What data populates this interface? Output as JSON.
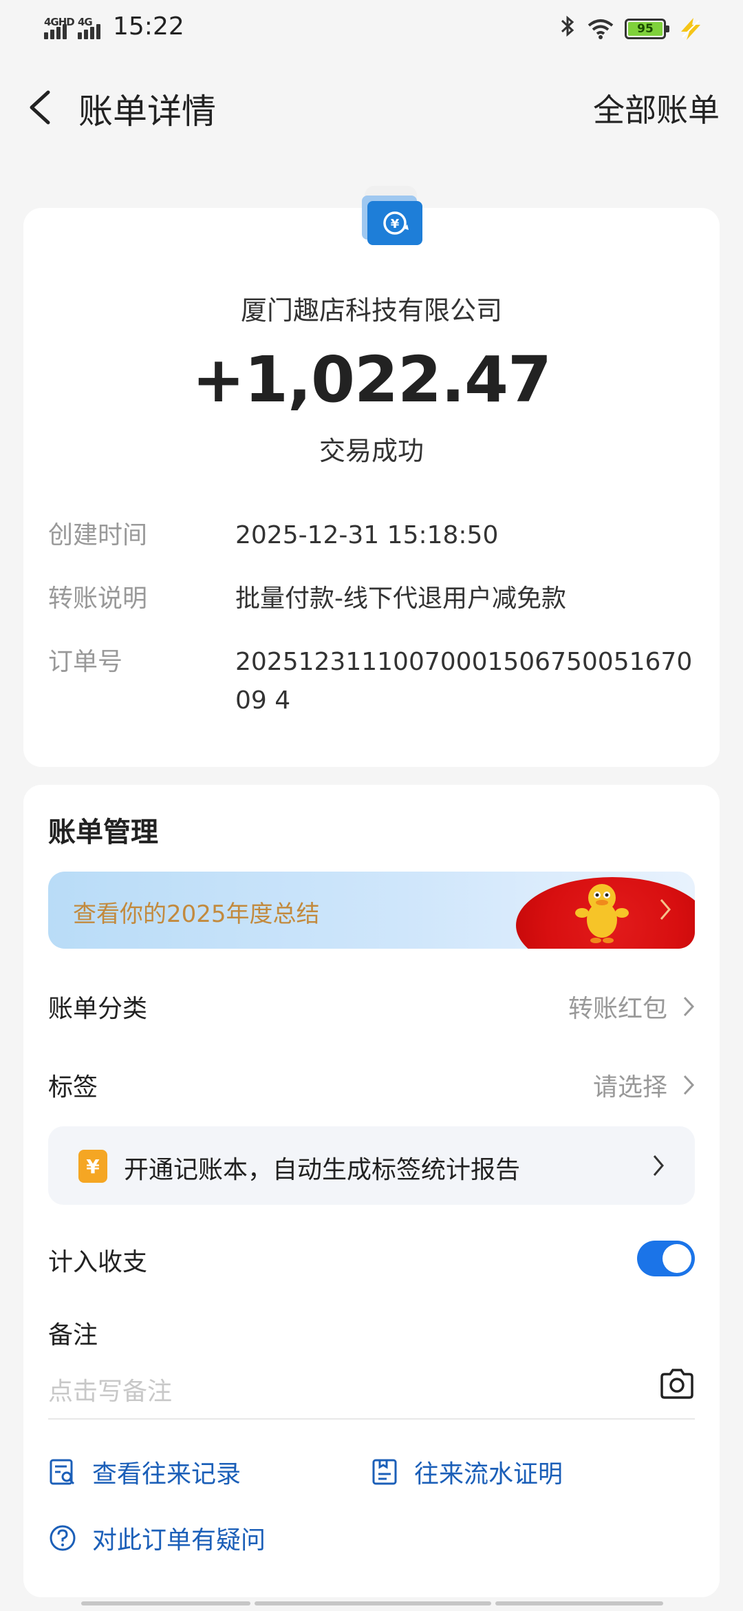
{
  "status_bar": {
    "signal1_label": "4GHD",
    "signal2_label": "4G",
    "time": "15:22",
    "battery": "95"
  },
  "header": {
    "title": "账单详情",
    "all_bills": "全部账单"
  },
  "bill": {
    "payee": "厦门趣店科技有限公司",
    "amount": "+1,022.47",
    "status": "交易成功",
    "details": [
      {
        "label": "创建时间",
        "value": "2025-12-31 15:18:50"
      },
      {
        "label": "转账说明",
        "value": "批量付款-线下代退用户减免款"
      },
      {
        "label": "订单号",
        "value": "2025123111007000150675005167009 4"
      }
    ]
  },
  "management": {
    "title": "账单管理",
    "banner_text": "查看你的2025年度总结",
    "category_label": "账单分类",
    "category_value": "转账红包",
    "tag_label": "标签",
    "tag_value": "请选择",
    "promo_icon": "¥",
    "promo_text": "开通记账本，自动生成标签统计报告",
    "count_label": "计入收支",
    "count_enabled": true,
    "note_label": "备注",
    "note_placeholder": "点击写备注",
    "note_value": "",
    "links": {
      "history": "查看往来记录",
      "proof": "往来流水证明",
      "question": "对此订单有疑问"
    }
  }
}
